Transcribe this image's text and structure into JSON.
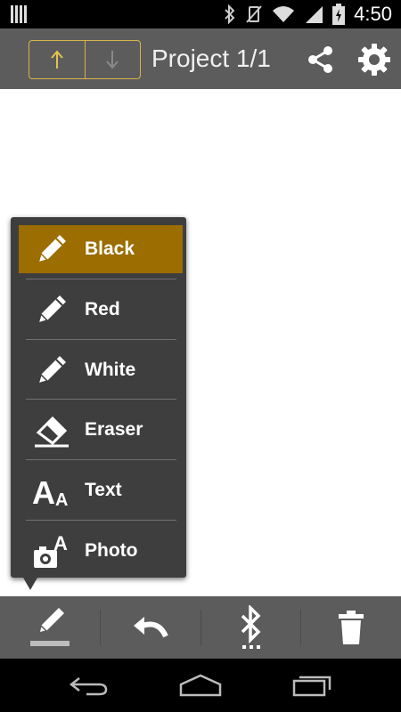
{
  "status_bar": {
    "time": "4:50",
    "icons": [
      "notification-icon",
      "bluetooth-icon",
      "vibrate-off-icon",
      "wifi-icon",
      "signal-icon",
      "battery-charging-icon"
    ]
  },
  "app_bar": {
    "title": "Project 1/1",
    "up_icon": "arrow-up-icon",
    "down_icon": "arrow-down-icon",
    "share_icon": "share-icon",
    "settings_icon": "gear-icon",
    "accent_color": "#d8b54a"
  },
  "tool_menu": {
    "selected_color": "#9c6d00",
    "items": [
      {
        "label": "Black",
        "icon": "pencil-icon",
        "selected": true
      },
      {
        "label": "Red",
        "icon": "pencil-icon",
        "selected": false
      },
      {
        "label": "White",
        "icon": "pencil-icon",
        "selected": false
      },
      {
        "label": "Eraser",
        "icon": "eraser-icon",
        "selected": false
      },
      {
        "label": "Text",
        "icon": "text-icon",
        "selected": false
      },
      {
        "label": "Photo",
        "icon": "photo-text-icon",
        "selected": false
      }
    ]
  },
  "bottom_toolbar": {
    "buttons": [
      "pen-icon",
      "undo-icon",
      "bluetooth-icon",
      "trash-icon"
    ]
  },
  "system_nav": {
    "buttons": [
      "back-icon",
      "home-icon",
      "recents-icon"
    ]
  }
}
